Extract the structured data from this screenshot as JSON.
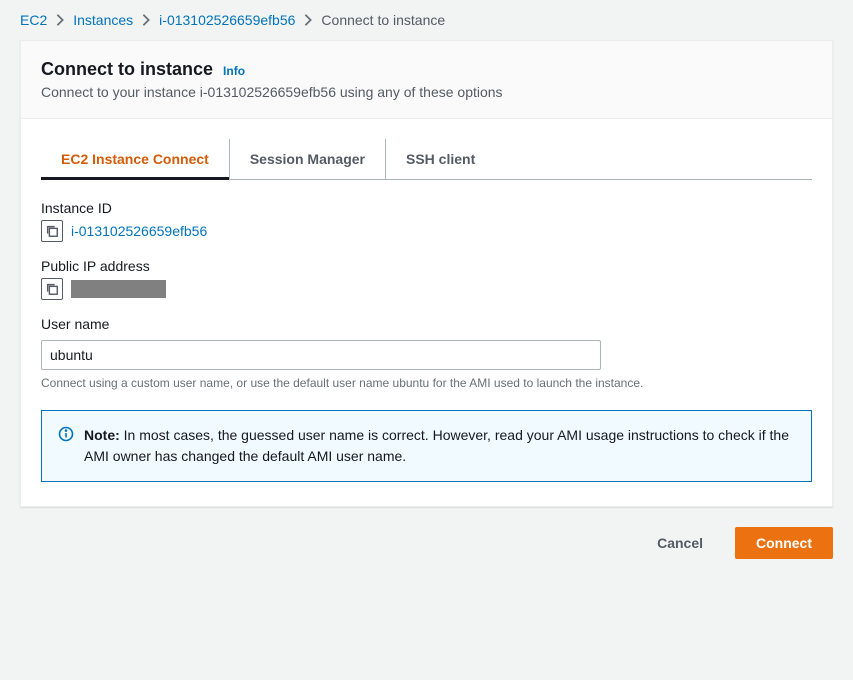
{
  "breadcrumb": {
    "items": [
      {
        "label": "EC2"
      },
      {
        "label": "Instances"
      },
      {
        "label": "i-013102526659efb56"
      }
    ],
    "current": "Connect to instance"
  },
  "header": {
    "title": "Connect to instance",
    "info_label": "Info",
    "subtitle": "Connect to your instance i-013102526659efb56 using any of these options"
  },
  "tabs": [
    {
      "label": "EC2 Instance Connect"
    },
    {
      "label": "Session Manager"
    },
    {
      "label": "SSH client"
    }
  ],
  "fields": {
    "instance_id": {
      "label": "Instance ID",
      "value": "i-013102526659efb56"
    },
    "public_ip": {
      "label": "Public IP address",
      "value": ""
    },
    "username": {
      "label": "User name",
      "value": "ubuntu",
      "helper": "Connect using a custom user name, or use the default user name ubuntu for the AMI used to launch the instance."
    }
  },
  "note": {
    "bold": "Note:",
    "text": "In most cases, the guessed user name is correct. However, read your AMI usage instructions to check if the AMI owner has changed the default AMI user name."
  },
  "footer": {
    "cancel": "Cancel",
    "connect": "Connect"
  },
  "icons": {
    "copy": "copy-icon",
    "info": "info-icon",
    "chevron": "chevron-right-icon"
  }
}
